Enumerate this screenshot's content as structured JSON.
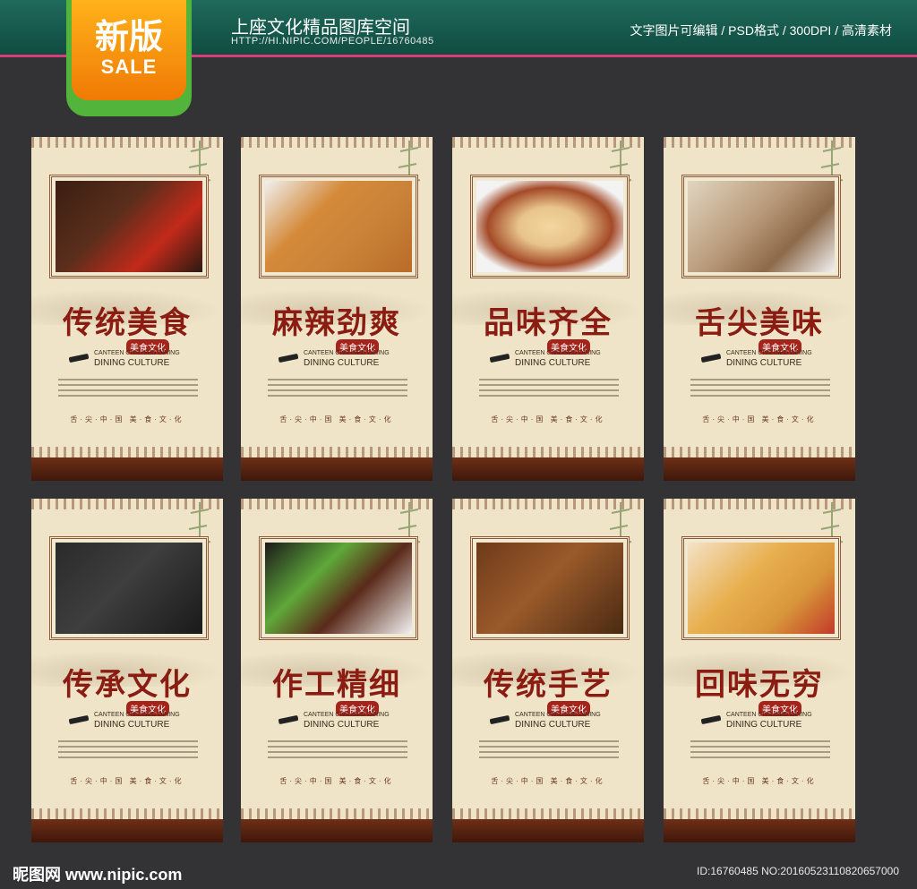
{
  "header": {
    "badge_big": "新版",
    "badge_small": "SALE",
    "title": "上座文化精品图库空间",
    "url": "HTTP://HI.NIPIC.COM/PEOPLE/16760485",
    "meta": "文字图片可编辑 / PSD格式 / 300DPI / 高清素材"
  },
  "posters": [
    {
      "headline": "传统美食"
    },
    {
      "headline": "麻辣劲爽"
    },
    {
      "headline": "品味齐全"
    },
    {
      "headline": "舌尖美味"
    },
    {
      "headline": "传承文化"
    },
    {
      "headline": "作工精细"
    },
    {
      "headline": "传统手艺"
    },
    {
      "headline": "回味无穷"
    }
  ],
  "poster_common": {
    "sub_cn": "美食文化",
    "sub_en1": "CANTEEN CIVILISED DINING",
    "sub_en2": "DINING CULTURE",
    "footer": "舌·尖·中·国 美·食·文·化"
  },
  "footer": {
    "left": "昵图网 www.nipic.com",
    "right": "ID:16760485 NO:20160523110820657000"
  }
}
